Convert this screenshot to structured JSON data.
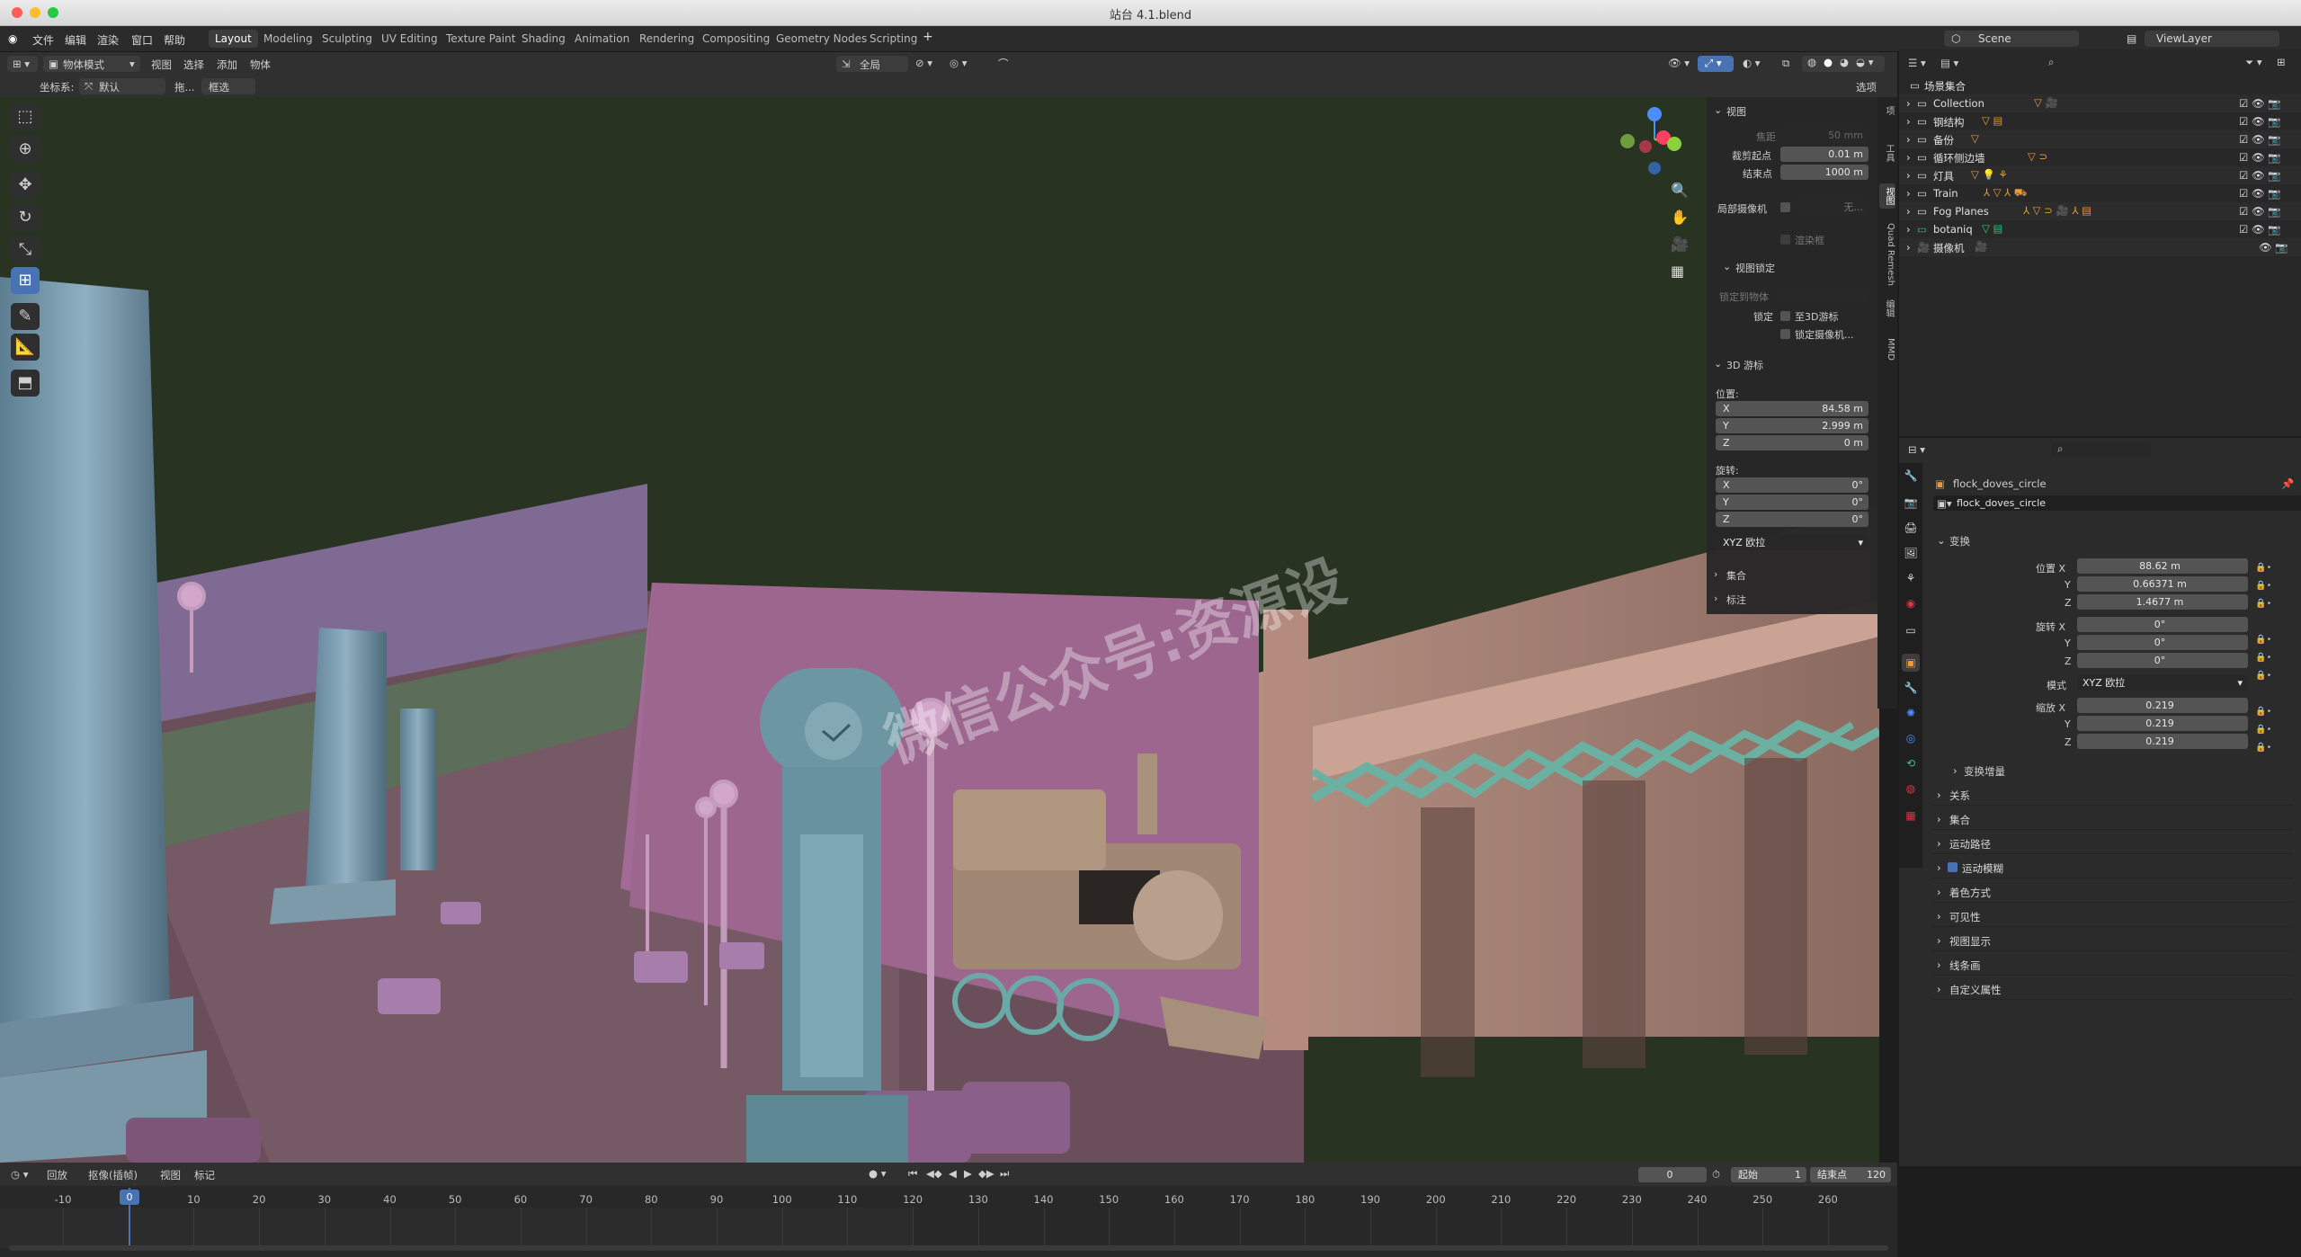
{
  "window": {
    "title": "站台 4.1.blend"
  },
  "menu": {
    "items": [
      "文件",
      "编辑",
      "渲染",
      "窗口",
      "帮助"
    ]
  },
  "workspaces": [
    "Layout",
    "Modeling",
    "Sculpting",
    "UV Editing",
    "Texture Paint",
    "Shading",
    "Animation",
    "Rendering",
    "Compositing",
    "Geometry Nodes",
    "Scripting"
  ],
  "scene": {
    "name": "Scene",
    "view_layer": "ViewLayer"
  },
  "viewport_header": {
    "mode": "物体模式",
    "menus": [
      "视图",
      "选择",
      "添加",
      "物体"
    ],
    "transform_orientation_label": "坐标系:",
    "transform_orientation": "默认",
    "drag_label": "拖...",
    "select_mode": "框选",
    "pivot": "全局",
    "options": "选项"
  },
  "watermark": "微信公众号:资源设",
  "npanel": {
    "view_section": "视图",
    "focal_label": "焦距",
    "focal_value": "50 mm",
    "clip_start_label": "裁剪起点",
    "clip_start": "0.01 m",
    "clip_end_label": "结束点",
    "clip_end": "1000 m",
    "local_camera_label": "局部摄像机",
    "local_camera_value": "无...",
    "render_region": "渲染框",
    "view_lock_section": "视图锁定",
    "lock_to_object": "锁定到物体",
    "lock_label": "锁定",
    "lock_to_cursor": "至3D游标",
    "lock_camera": "锁定摄像机...",
    "cursor_section": "3D 游标",
    "location_label": "位置:",
    "loc_x": "84.58 m",
    "loc_y": "2.999 m",
    "loc_z": "0 m",
    "rotation_label": "旋转:",
    "rot_x": "0°",
    "rot_y": "0°",
    "rot_z": "0°",
    "rotation_mode": "XYZ 欧拉",
    "collection_section": "集合",
    "annotation_section": "标注",
    "tabs": [
      "项",
      "工具",
      "视图",
      "Quad Remesh",
      "编辑",
      "MMD"
    ]
  },
  "outliner": {
    "root": "场景集合",
    "items": [
      "Collection",
      "钢结构",
      "备份",
      "循环侧边墙",
      "灯具",
      "Train",
      "Fog Planes",
      "botaniq",
      "摄像机"
    ]
  },
  "properties": {
    "object_name": "flock_doves_circle",
    "datablock": "flock_doves_circle",
    "transform_section": "变换",
    "loc_label": "位置 X",
    "loc_x": "88.62 m",
    "loc_y": "0.66371 m",
    "loc_z": "1.4677 m",
    "rot_label": "旋转 X",
    "rot_x": "0°",
    "rot_y": "0°",
    "rot_z": "0°",
    "mode_label": "模式",
    "mode": "XYZ 欧拉",
    "scale_label": "缩放 X",
    "scale_x": "0.219",
    "scale_y": "0.219",
    "scale_z": "0.219",
    "axis_y": "Y",
    "axis_z": "Z",
    "delta_transform": "变换增量",
    "sections": [
      "关系",
      "集合",
      "运动路径",
      "运动模糊",
      "着色方式",
      "可见性",
      "视图显示",
      "线条画",
      "自定义属性"
    ]
  },
  "timeline": {
    "playback": "回放",
    "keying": "抠像(插帧)",
    "view": "视图",
    "marker": "标记",
    "current_frame": "0",
    "start_label": "起始",
    "start": "1",
    "end_label": "结束点",
    "end": "120",
    "ticks": [
      "-10",
      "0",
      "10",
      "20",
      "30",
      "40",
      "50",
      "60",
      "70",
      "80",
      "90",
      "100",
      "110",
      "120",
      "130",
      "140",
      "150",
      "160",
      "170",
      "180",
      "190",
      "200",
      "210",
      "220",
      "230",
      "240",
      "250",
      "260"
    ]
  }
}
